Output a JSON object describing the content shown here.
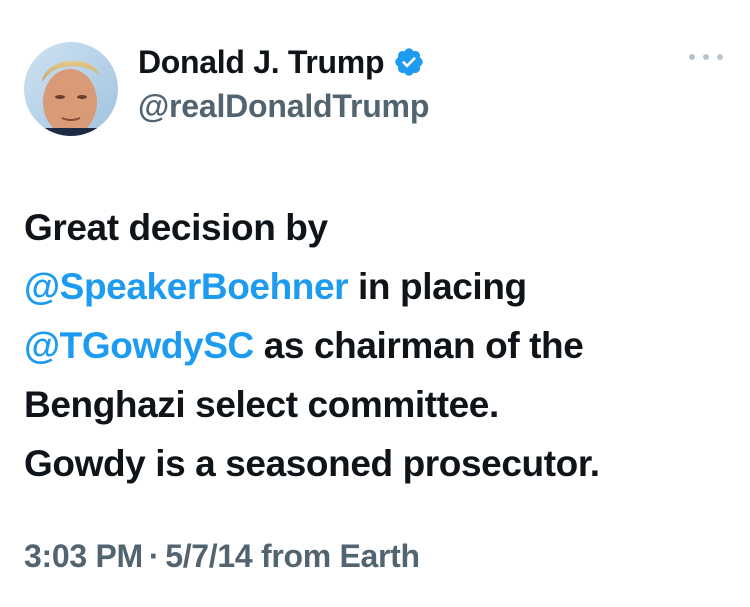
{
  "author": {
    "display_name": "Donald J. Trump",
    "handle": "@realDonaldTrump",
    "verified": true,
    "verified_color": "#1d9bf0",
    "avatar": "profile-photo"
  },
  "more_icon": "more-horizontal-icon",
  "tweet": {
    "line1": "Great decision by",
    "mention1": "@SpeakerBoehner",
    "line2_rest": " in placing",
    "mention2": "@TGowdySC",
    "line3_rest": " as chairman of the",
    "line4": "Benghazi select committee.",
    "line5": "Gowdy is a seasoned prosecutor."
  },
  "meta": {
    "time": "3:03 PM",
    "separator": "·",
    "date": "5/7/14",
    "source": "from Earth"
  },
  "colors": {
    "text": "#0f1419",
    "secondary": "#536471",
    "link": "#1d9bf0"
  }
}
